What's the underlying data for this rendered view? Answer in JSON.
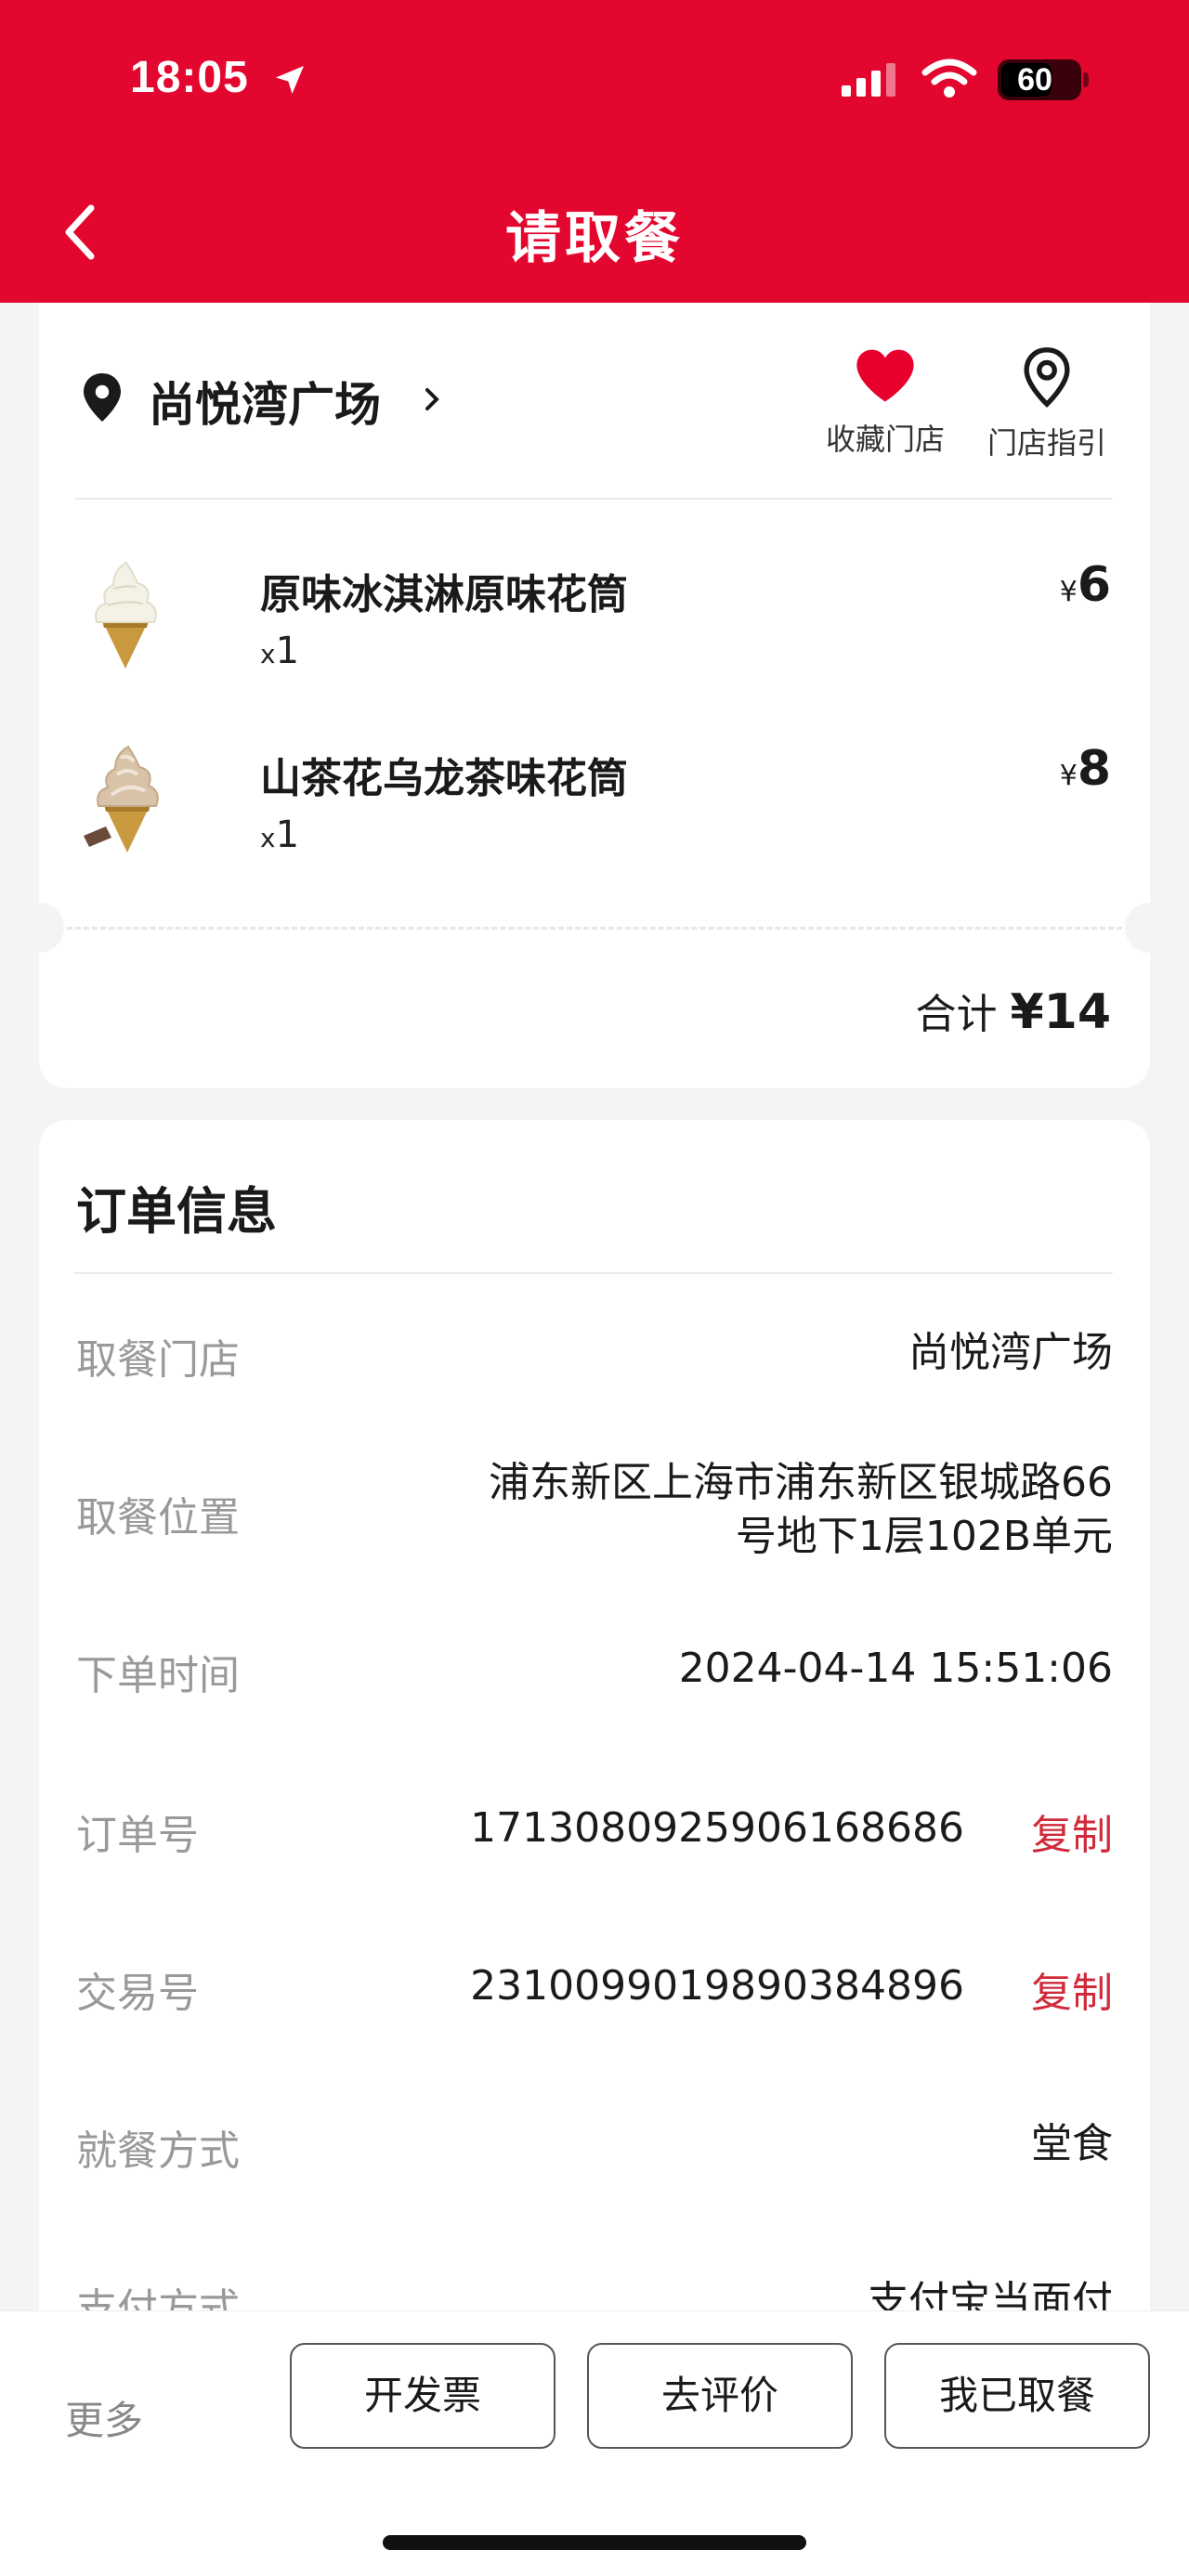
{
  "status_bar": {
    "time": "18:05",
    "battery": "60"
  },
  "header": {
    "title": "请取餐"
  },
  "store": {
    "name": "尚悦湾广场",
    "favorite_label": "收藏门店",
    "guide_label": "门店指引"
  },
  "items": [
    {
      "name": "原味冰淇淋原味花筒",
      "qty_prefix": "x",
      "qty": "1",
      "currency": "¥",
      "price": "6"
    },
    {
      "name": "山茶花乌龙茶味花筒",
      "qty_prefix": "x",
      "qty": "1",
      "currency": "¥",
      "price": "8"
    }
  ],
  "total": {
    "label": "合计",
    "amount": "¥14"
  },
  "order_info": {
    "title": "订单信息",
    "rows": [
      {
        "label": "取餐门店",
        "value": "尚悦湾广场"
      },
      {
        "label": "取餐位置",
        "value_line1": "浦东新区上海市浦东新区银城路66",
        "value_line2": "号地下1层102B单元"
      },
      {
        "label": "下单时间",
        "value": "2024-04-14 15:51:06"
      },
      {
        "label": "订单号",
        "value": "1713080925906168686",
        "action": "复制"
      },
      {
        "label": "交易号",
        "value": "2310099019890384896",
        "action": "复制"
      },
      {
        "label": "就餐方式",
        "value": "堂食"
      },
      {
        "label": "支付方式",
        "value": "支付宝当面付"
      }
    ]
  },
  "bottom_bar": {
    "more": "更多",
    "invoice": "开发票",
    "review": "去评价",
    "picked_up": "我已取餐"
  },
  "colors": {
    "brand_red": "#e3072f",
    "copy_red": "#d12a3a",
    "heart_red": "#e8002c"
  }
}
